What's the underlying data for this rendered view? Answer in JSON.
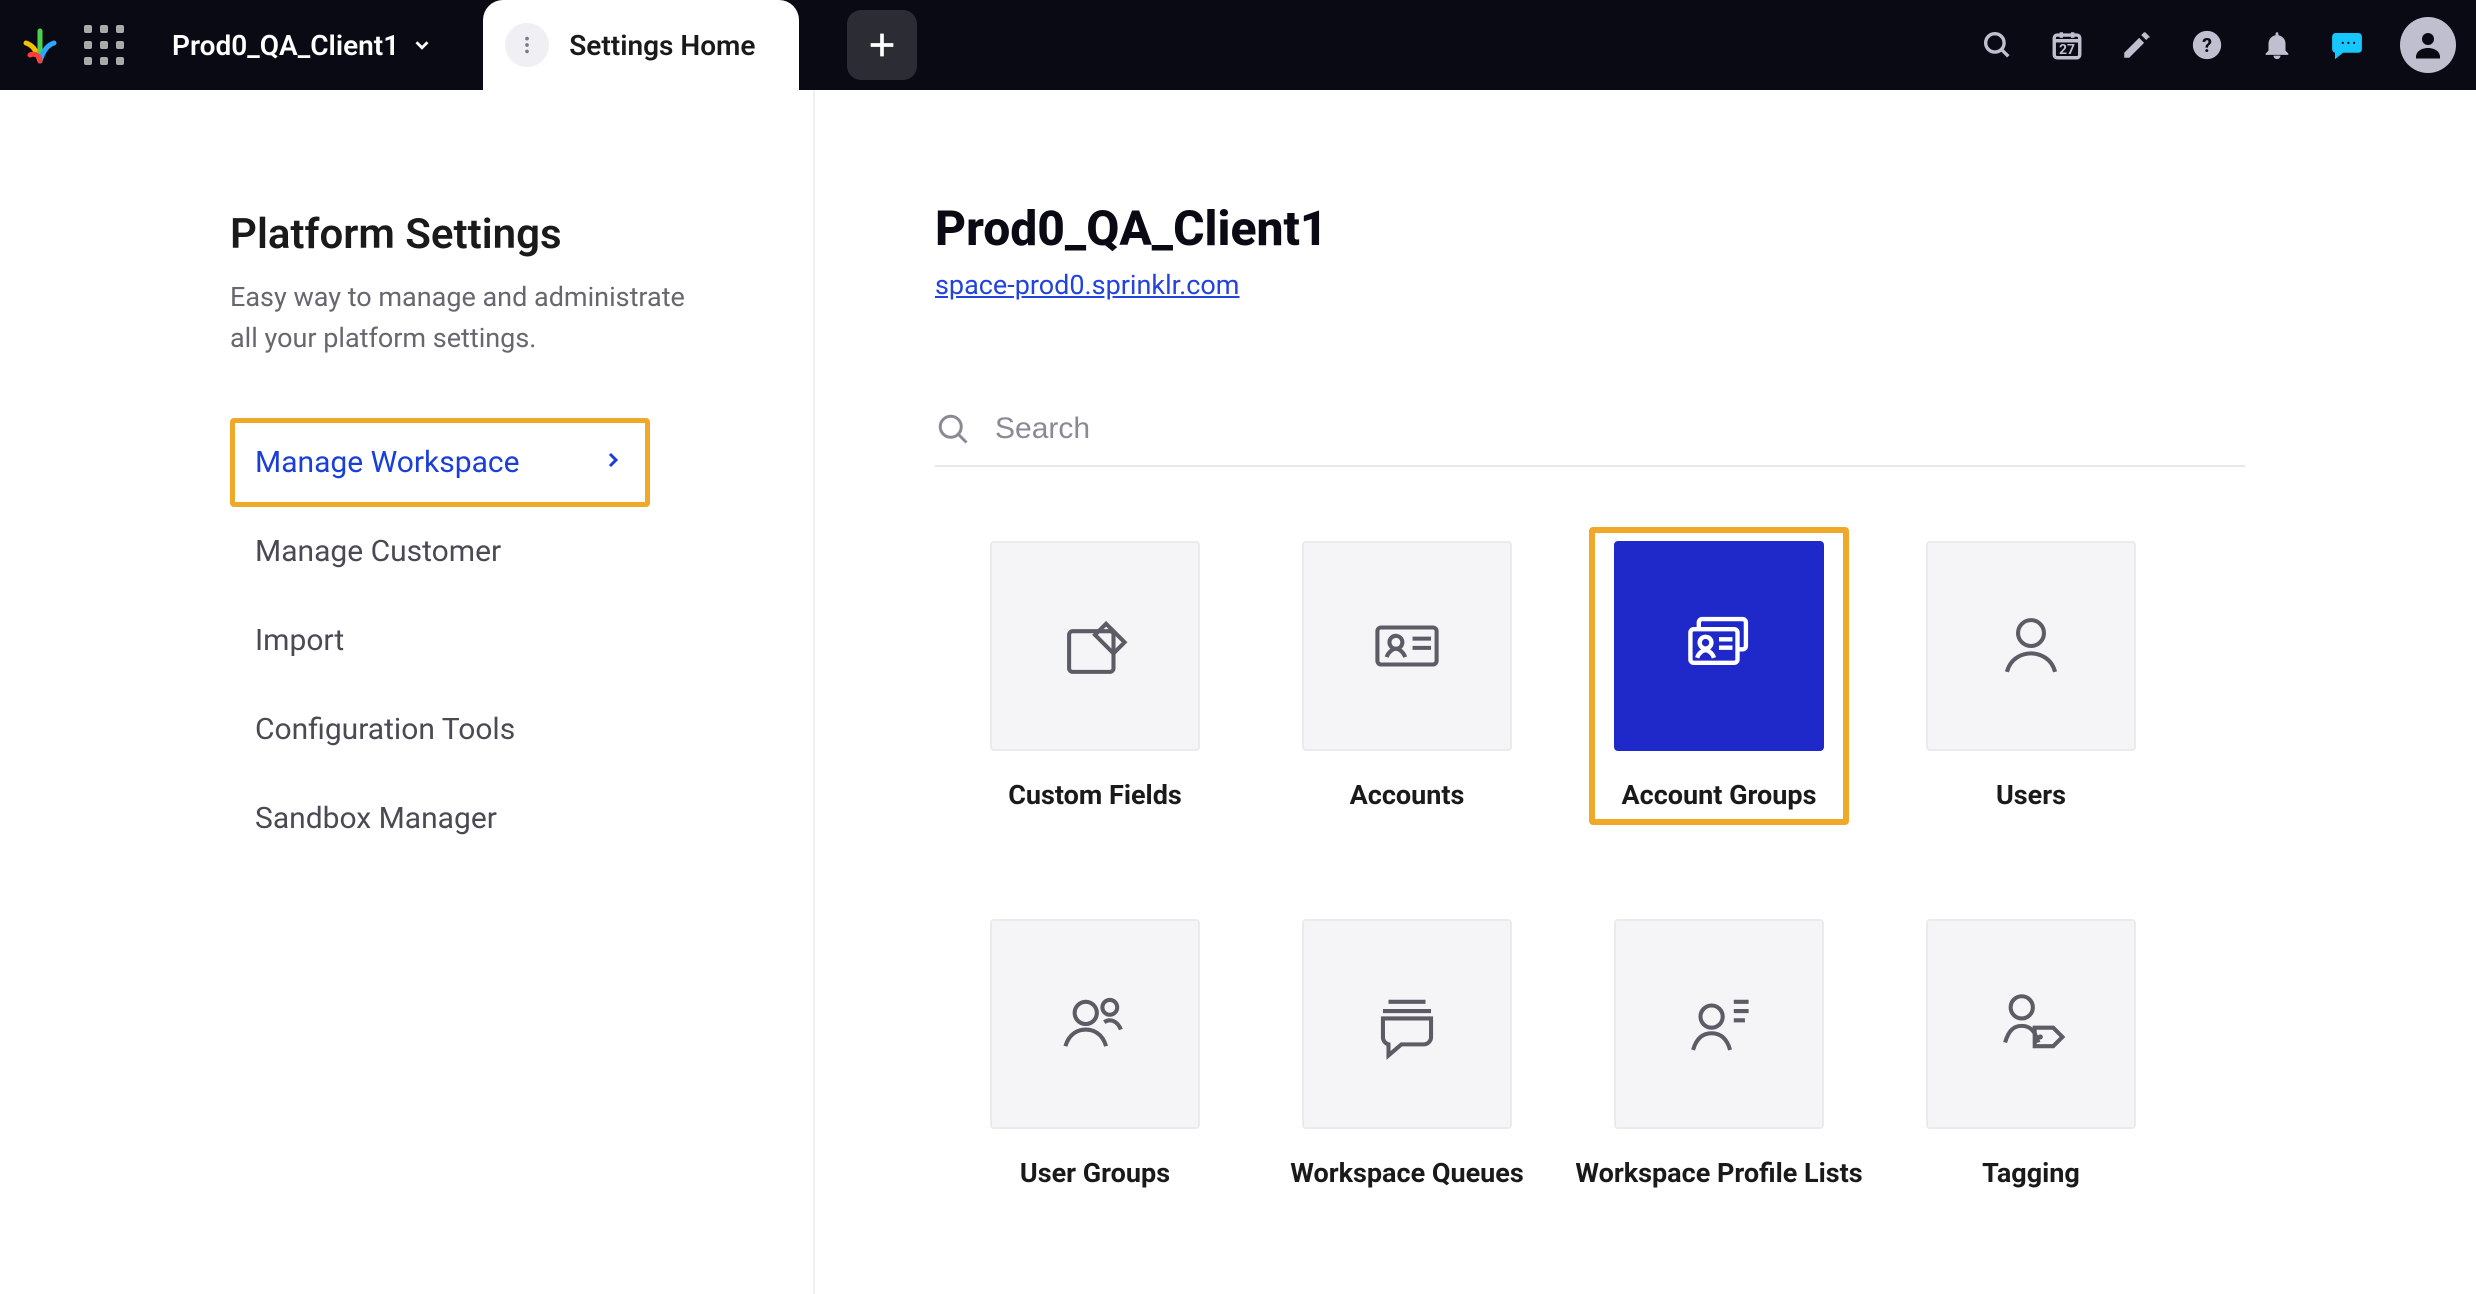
{
  "topbar": {
    "workspace_name": "Prod0_QA_Client1",
    "tab_title": "Settings Home",
    "calendar_day": "27",
    "icons": {
      "search": "search-icon",
      "calendar": "calendar-icon",
      "edit": "edit-icon",
      "help": "help-icon",
      "notifications": "bell-icon",
      "chat": "chat-icon",
      "profile": "profile-icon"
    }
  },
  "sidebar": {
    "heading": "Platform Settings",
    "description": "Easy way to manage and administrate all your platform settings.",
    "items": [
      {
        "label": "Manage Workspace",
        "active": true
      },
      {
        "label": "Manage Customer",
        "active": false
      },
      {
        "label": "Import",
        "active": false
      },
      {
        "label": "Configuration Tools",
        "active": false
      },
      {
        "label": "Sandbox Manager",
        "active": false
      }
    ]
  },
  "content": {
    "title": "Prod0_QA_Client1",
    "url": "space-prod0.sprinklr.com",
    "search_placeholder": "Search",
    "tiles": [
      {
        "label": "Custom Fields",
        "icon": "custom-fields-icon",
        "highlight": false
      },
      {
        "label": "Accounts",
        "icon": "accounts-icon",
        "highlight": false
      },
      {
        "label": "Account Groups",
        "icon": "account-groups-icon",
        "highlight": true
      },
      {
        "label": "Users",
        "icon": "users-icon",
        "highlight": false
      },
      {
        "label": "User Groups",
        "icon": "user-groups-icon",
        "highlight": false
      },
      {
        "label": "Workspace Queues",
        "icon": "workspace-queues-icon",
        "highlight": false
      },
      {
        "label": "Workspace Profile Lists",
        "icon": "workspace-profile-lists-icon",
        "highlight": false
      },
      {
        "label": "Tagging",
        "icon": "tagging-icon",
        "highlight": false
      }
    ]
  }
}
